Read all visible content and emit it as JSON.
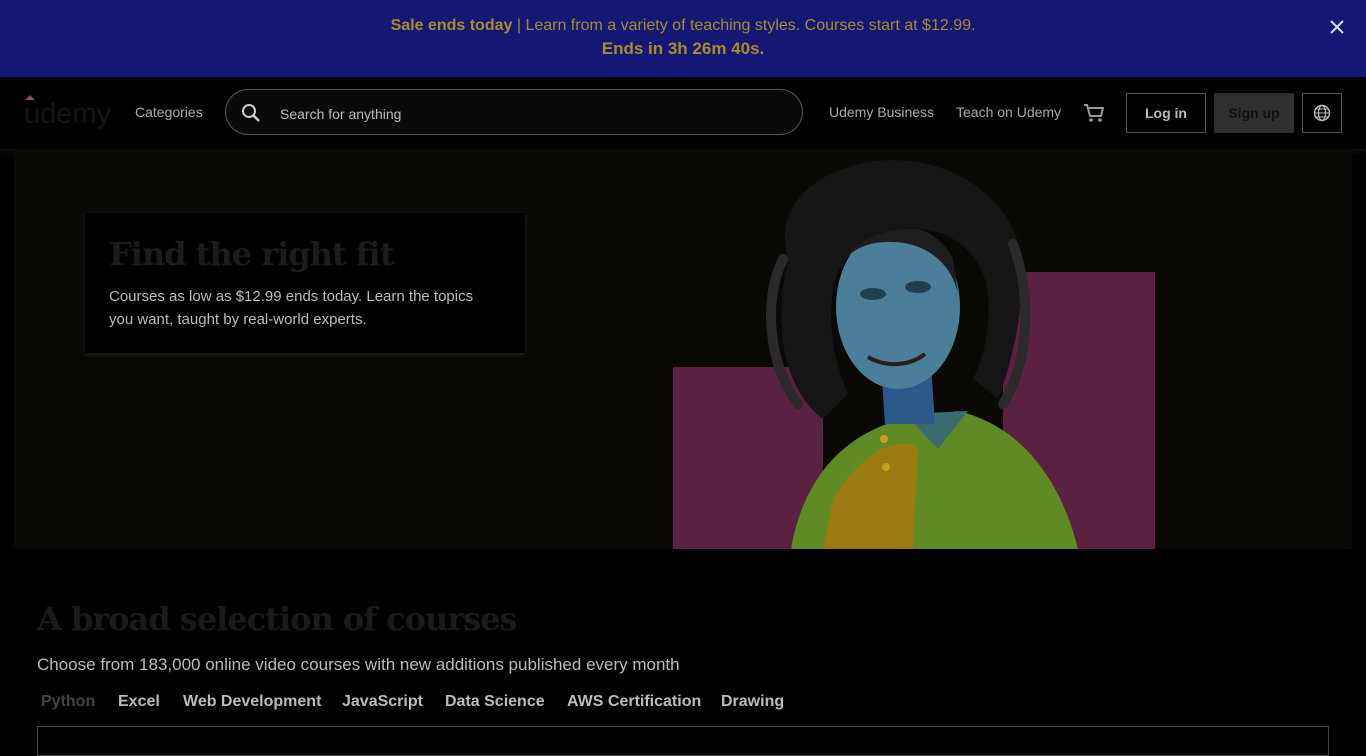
{
  "banner": {
    "highlight": "Sale ends today",
    "message": " | Learn from a variety of teaching styles. Courses start at $12.99.",
    "countdown": "Ends in 3h 26m 40s."
  },
  "header": {
    "logo_text": "udemy",
    "categories_label": "Categories",
    "search_placeholder": "Search for anything",
    "business_label": "Udemy Business",
    "teach_label": "Teach on Udemy",
    "login_label": "Log in",
    "signup_label": "Sign up"
  },
  "hero": {
    "title": "Find the right fit",
    "body": "Courses as low as $12.99 ends today. Learn the topics you want, taught by real-world experts."
  },
  "section": {
    "title": "A broad selection of courses",
    "subtitle": "Choose from 183,000 online video courses with new additions published every month"
  },
  "tabs": [
    {
      "label": "Python",
      "active": true
    },
    {
      "label": "Excel"
    },
    {
      "label": "Web Development"
    },
    {
      "label": "JavaScript"
    },
    {
      "label": "Data Science"
    },
    {
      "label": "AWS Certification"
    },
    {
      "label": "Drawing"
    }
  ],
  "colors": {
    "banner_bg": "#141773",
    "banner_text": "#a98c2d",
    "hero_accent": "#5a2240"
  }
}
